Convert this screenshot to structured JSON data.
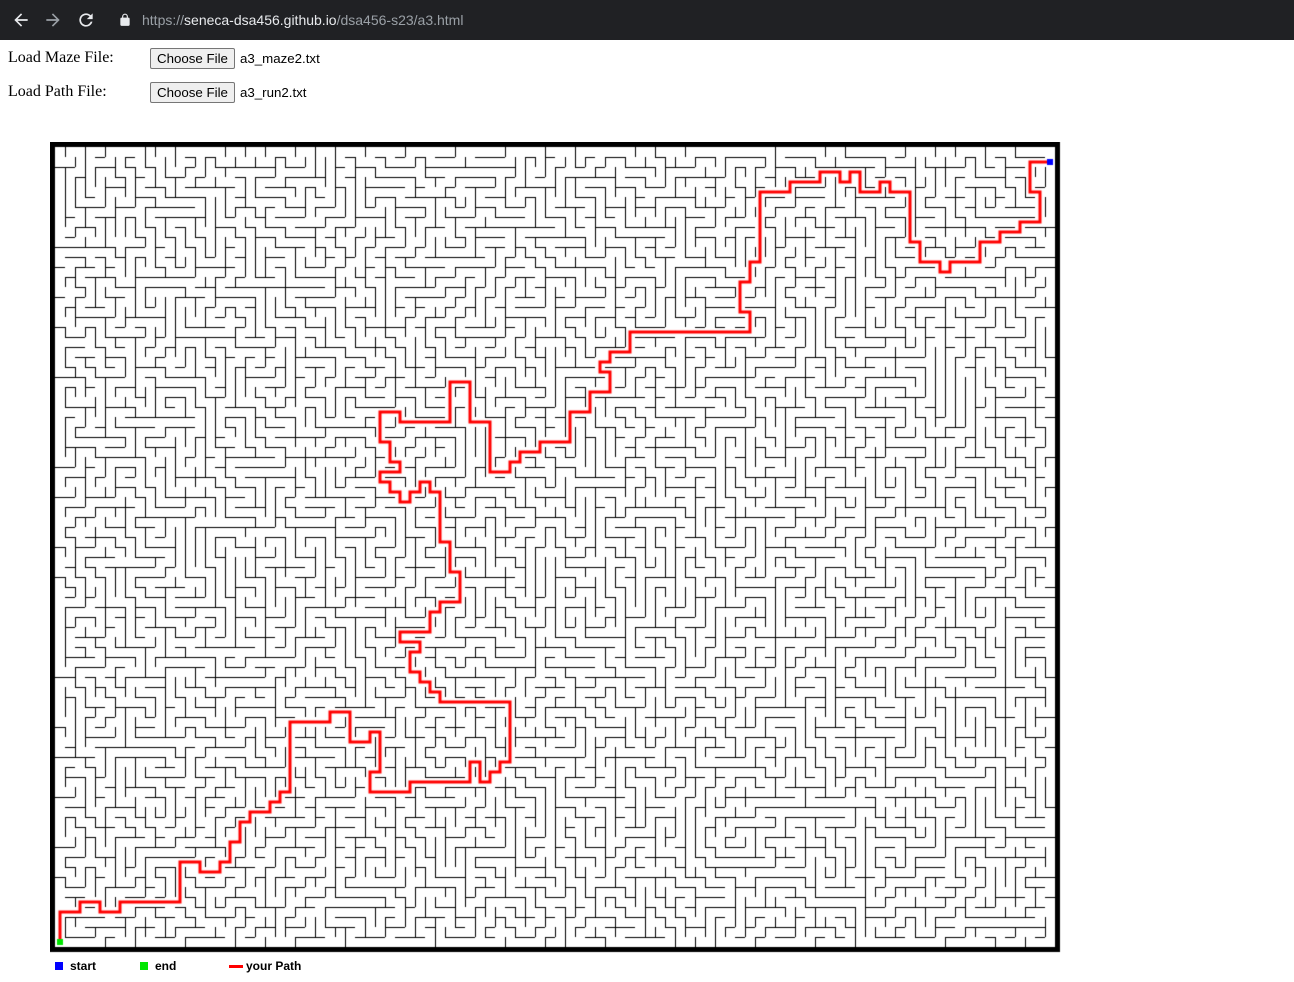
{
  "browser": {
    "url_scheme": "https://",
    "url_host": "seneca-dsa456.github.io",
    "url_path": "/dsa456-s23/a3.html"
  },
  "form": {
    "maze": {
      "label": "Load Maze File:",
      "button": "Choose File",
      "file": "a3_maze2.txt"
    },
    "path": {
      "label": "Load Path File:",
      "button": "Choose File",
      "file": "a3_run2.txt"
    }
  },
  "legend": {
    "start_label": "start",
    "end_label": "end",
    "path_label": "your Path"
  },
  "colors": {
    "start": "#0000ff",
    "end": "#00e600",
    "path": "#ff0000",
    "wall": "#000000"
  },
  "maze": {
    "cols": 100,
    "rows": 80,
    "path_cells": [
      [
        0,
        79
      ],
      [
        0,
        78
      ],
      [
        0,
        77
      ],
      [
        0,
        76
      ],
      [
        1,
        76
      ],
      [
        2,
        76
      ],
      [
        2,
        75
      ],
      [
        3,
        75
      ],
      [
        4,
        75
      ],
      [
        4,
        76
      ],
      [
        5,
        76
      ],
      [
        6,
        76
      ],
      [
        6,
        75
      ],
      [
        7,
        75
      ],
      [
        8,
        75
      ],
      [
        9,
        75
      ],
      [
        10,
        75
      ],
      [
        11,
        75
      ],
      [
        12,
        75
      ],
      [
        12,
        74
      ],
      [
        12,
        73
      ],
      [
        12,
        72
      ],
      [
        12,
        71
      ],
      [
        13,
        71
      ],
      [
        14,
        71
      ],
      [
        14,
        72
      ],
      [
        15,
        72
      ],
      [
        16,
        72
      ],
      [
        16,
        71
      ],
      [
        17,
        71
      ],
      [
        17,
        70
      ],
      [
        17,
        69
      ],
      [
        18,
        69
      ],
      [
        18,
        68
      ],
      [
        18,
        67
      ],
      [
        19,
        67
      ],
      [
        19,
        66
      ],
      [
        20,
        66
      ],
      [
        21,
        66
      ],
      [
        21,
        65
      ],
      [
        22,
        65
      ],
      [
        22,
        64
      ],
      [
        23,
        64
      ],
      [
        23,
        63
      ],
      [
        23,
        62
      ],
      [
        23,
        61
      ],
      [
        23,
        60
      ],
      [
        23,
        59
      ],
      [
        23,
        58
      ],
      [
        23,
        57
      ],
      [
        24,
        57
      ],
      [
        25,
        57
      ],
      [
        26,
        57
      ],
      [
        27,
        57
      ],
      [
        27,
        56
      ],
      [
        28,
        56
      ],
      [
        29,
        56
      ],
      [
        29,
        57
      ],
      [
        29,
        58
      ],
      [
        29,
        59
      ],
      [
        30,
        59
      ],
      [
        31,
        59
      ],
      [
        31,
        58
      ],
      [
        32,
        58
      ],
      [
        32,
        59
      ],
      [
        32,
        60
      ],
      [
        32,
        61
      ],
      [
        32,
        62
      ],
      [
        31,
        62
      ],
      [
        31,
        63
      ],
      [
        31,
        64
      ],
      [
        32,
        64
      ],
      [
        33,
        64
      ],
      [
        34,
        64
      ],
      [
        35,
        64
      ],
      [
        35,
        63
      ],
      [
        36,
        63
      ],
      [
        37,
        63
      ],
      [
        38,
        63
      ],
      [
        39,
        63
      ],
      [
        40,
        63
      ],
      [
        41,
        63
      ],
      [
        41,
        62
      ],
      [
        41,
        61
      ],
      [
        42,
        61
      ],
      [
        42,
        62
      ],
      [
        42,
        63
      ],
      [
        43,
        63
      ],
      [
        43,
        62
      ],
      [
        44,
        62
      ],
      [
        44,
        61
      ],
      [
        45,
        61
      ],
      [
        45,
        60
      ],
      [
        45,
        59
      ],
      [
        45,
        58
      ],
      [
        45,
        57
      ],
      [
        45,
        56
      ],
      [
        45,
        55
      ],
      [
        44,
        55
      ],
      [
        43,
        55
      ],
      [
        42,
        55
      ],
      [
        41,
        55
      ],
      [
        40,
        55
      ],
      [
        39,
        55
      ],
      [
        38,
        55
      ],
      [
        38,
        54
      ],
      [
        37,
        54
      ],
      [
        37,
        53
      ],
      [
        36,
        53
      ],
      [
        36,
        52
      ],
      [
        35,
        52
      ],
      [
        35,
        51
      ],
      [
        35,
        50
      ],
      [
        36,
        50
      ],
      [
        36,
        49
      ],
      [
        35,
        49
      ],
      [
        34,
        49
      ],
      [
        34,
        48
      ],
      [
        35,
        48
      ],
      [
        36,
        48
      ],
      [
        37,
        48
      ],
      [
        37,
        47
      ],
      [
        37,
        46
      ],
      [
        38,
        46
      ],
      [
        38,
        45
      ],
      [
        39,
        45
      ],
      [
        40,
        45
      ],
      [
        40,
        44
      ],
      [
        40,
        43
      ],
      [
        40,
        42
      ],
      [
        39,
        42
      ],
      [
        39,
        41
      ],
      [
        39,
        40
      ],
      [
        39,
        39
      ],
      [
        38,
        39
      ],
      [
        38,
        38
      ],
      [
        38,
        37
      ],
      [
        38,
        36
      ],
      [
        38,
        35
      ],
      [
        38,
        34
      ],
      [
        37,
        34
      ],
      [
        37,
        33
      ],
      [
        36,
        33
      ],
      [
        36,
        34
      ],
      [
        35,
        34
      ],
      [
        35,
        35
      ],
      [
        34,
        35
      ],
      [
        34,
        34
      ],
      [
        33,
        34
      ],
      [
        33,
        33
      ],
      [
        32,
        33
      ],
      [
        32,
        32
      ],
      [
        33,
        32
      ],
      [
        34,
        32
      ],
      [
        34,
        31
      ],
      [
        33,
        31
      ],
      [
        33,
        30
      ],
      [
        33,
        29
      ],
      [
        32,
        29
      ],
      [
        32,
        28
      ],
      [
        32,
        27
      ],
      [
        32,
        26
      ],
      [
        33,
        26
      ],
      [
        34,
        26
      ],
      [
        34,
        27
      ],
      [
        35,
        27
      ],
      [
        36,
        27
      ],
      [
        37,
        27
      ],
      [
        38,
        27
      ],
      [
        39,
        27
      ],
      [
        39,
        26
      ],
      [
        39,
        25
      ],
      [
        39,
        24
      ],
      [
        39,
        23
      ],
      [
        40,
        23
      ],
      [
        41,
        23
      ],
      [
        41,
        24
      ],
      [
        41,
        25
      ],
      [
        41,
        26
      ],
      [
        41,
        27
      ],
      [
        42,
        27
      ],
      [
        43,
        27
      ],
      [
        43,
        28
      ],
      [
        43,
        29
      ],
      [
        43,
        30
      ],
      [
        43,
        31
      ],
      [
        43,
        32
      ],
      [
        44,
        32
      ],
      [
        45,
        32
      ],
      [
        45,
        31
      ],
      [
        46,
        31
      ],
      [
        46,
        30
      ],
      [
        47,
        30
      ],
      [
        48,
        30
      ],
      [
        48,
        29
      ],
      [
        49,
        29
      ],
      [
        50,
        29
      ],
      [
        51,
        29
      ],
      [
        51,
        28
      ],
      [
        51,
        27
      ],
      [
        51,
        26
      ],
      [
        52,
        26
      ],
      [
        53,
        26
      ],
      [
        53,
        25
      ],
      [
        53,
        24
      ],
      [
        54,
        24
      ],
      [
        55,
        24
      ],
      [
        55,
        23
      ],
      [
        55,
        22
      ],
      [
        54,
        22
      ],
      [
        54,
        21
      ],
      [
        55,
        21
      ],
      [
        55,
        20
      ],
      [
        56,
        20
      ],
      [
        57,
        20
      ],
      [
        57,
        19
      ],
      [
        57,
        18
      ],
      [
        58,
        18
      ],
      [
        59,
        18
      ],
      [
        60,
        18
      ],
      [
        61,
        18
      ],
      [
        62,
        18
      ],
      [
        63,
        18
      ],
      [
        64,
        18
      ],
      [
        65,
        18
      ],
      [
        66,
        18
      ],
      [
        67,
        18
      ],
      [
        68,
        18
      ],
      [
        69,
        18
      ],
      [
        69,
        17
      ],
      [
        69,
        16
      ],
      [
        68,
        16
      ],
      [
        68,
        15
      ],
      [
        68,
        14
      ],
      [
        68,
        13
      ],
      [
        69,
        13
      ],
      [
        69,
        12
      ],
      [
        69,
        11
      ],
      [
        70,
        11
      ],
      [
        70,
        10
      ],
      [
        70,
        9
      ],
      [
        70,
        8
      ],
      [
        70,
        7
      ],
      [
        70,
        6
      ],
      [
        70,
        5
      ],
      [
        70,
        4
      ],
      [
        71,
        4
      ],
      [
        72,
        4
      ],
      [
        73,
        4
      ],
      [
        73,
        3
      ],
      [
        74,
        3
      ],
      [
        75,
        3
      ],
      [
        76,
        3
      ],
      [
        76,
        2
      ],
      [
        77,
        2
      ],
      [
        78,
        2
      ],
      [
        78,
        3
      ],
      [
        79,
        3
      ],
      [
        79,
        2
      ],
      [
        80,
        2
      ],
      [
        80,
        3
      ],
      [
        80,
        4
      ],
      [
        81,
        4
      ],
      [
        82,
        4
      ],
      [
        82,
        3
      ],
      [
        83,
        3
      ],
      [
        83,
        4
      ],
      [
        84,
        4
      ],
      [
        85,
        4
      ],
      [
        85,
        5
      ],
      [
        85,
        6
      ],
      [
        85,
        7
      ],
      [
        85,
        8
      ],
      [
        85,
        9
      ],
      [
        86,
        9
      ],
      [
        86,
        10
      ],
      [
        86,
        11
      ],
      [
        87,
        11
      ],
      [
        88,
        11
      ],
      [
        88,
        12
      ],
      [
        89,
        12
      ],
      [
        89,
        11
      ],
      [
        90,
        11
      ],
      [
        91,
        11
      ],
      [
        92,
        11
      ],
      [
        92,
        10
      ],
      [
        92,
        9
      ],
      [
        93,
        9
      ],
      [
        94,
        9
      ],
      [
        94,
        8
      ],
      [
        95,
        8
      ],
      [
        96,
        8
      ],
      [
        96,
        7
      ],
      [
        97,
        7
      ],
      [
        98,
        7
      ],
      [
        98,
        6
      ],
      [
        98,
        5
      ],
      [
        98,
        4
      ],
      [
        97,
        4
      ],
      [
        97,
        3
      ],
      [
        97,
        2
      ],
      [
        97,
        1
      ],
      [
        98,
        1
      ],
      [
        99,
        1
      ]
    ]
  }
}
